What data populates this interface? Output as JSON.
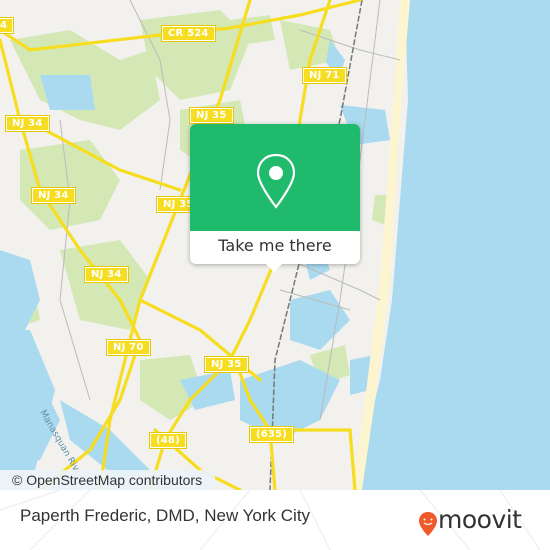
{
  "map": {
    "colors": {
      "land": "#f2f1ed",
      "water": "#aadaef",
      "park": "#d3e8b5",
      "road": "#f6dd1f",
      "beach": "#fdf5d0",
      "accent": "#1fba6b",
      "brand": "#f05a28"
    },
    "shields": [
      {
        "id": "nj34-top-left",
        "label": "4"
      },
      {
        "id": "cr524",
        "label": "CR 524"
      },
      {
        "id": "nj35-north",
        "label": "NJ 35"
      },
      {
        "id": "nj71",
        "label": "NJ 71"
      },
      {
        "id": "nj34-a",
        "label": "NJ 34"
      },
      {
        "id": "nj34-b",
        "label": "NJ 34"
      },
      {
        "id": "nj35-mid",
        "label": "NJ 35"
      },
      {
        "id": "nj34-c",
        "label": "NJ 34"
      },
      {
        "id": "nj70",
        "label": "NJ 70"
      },
      {
        "id": "nj35-south",
        "label": "NJ 35"
      },
      {
        "id": "rt48",
        "label": "(48)"
      },
      {
        "id": "rt635",
        "label": "(635)"
      }
    ],
    "water_label": "Manasquan River",
    "attribution": "© OpenStreetMap contributors"
  },
  "popup": {
    "icon": "map-pin-icon",
    "button_label": "Take me there"
  },
  "footer": {
    "place_title": "Paperth Frederic, DMD, New York City",
    "brand_name": "moovit",
    "brand_icon": "moovit-smile-pin-icon"
  }
}
